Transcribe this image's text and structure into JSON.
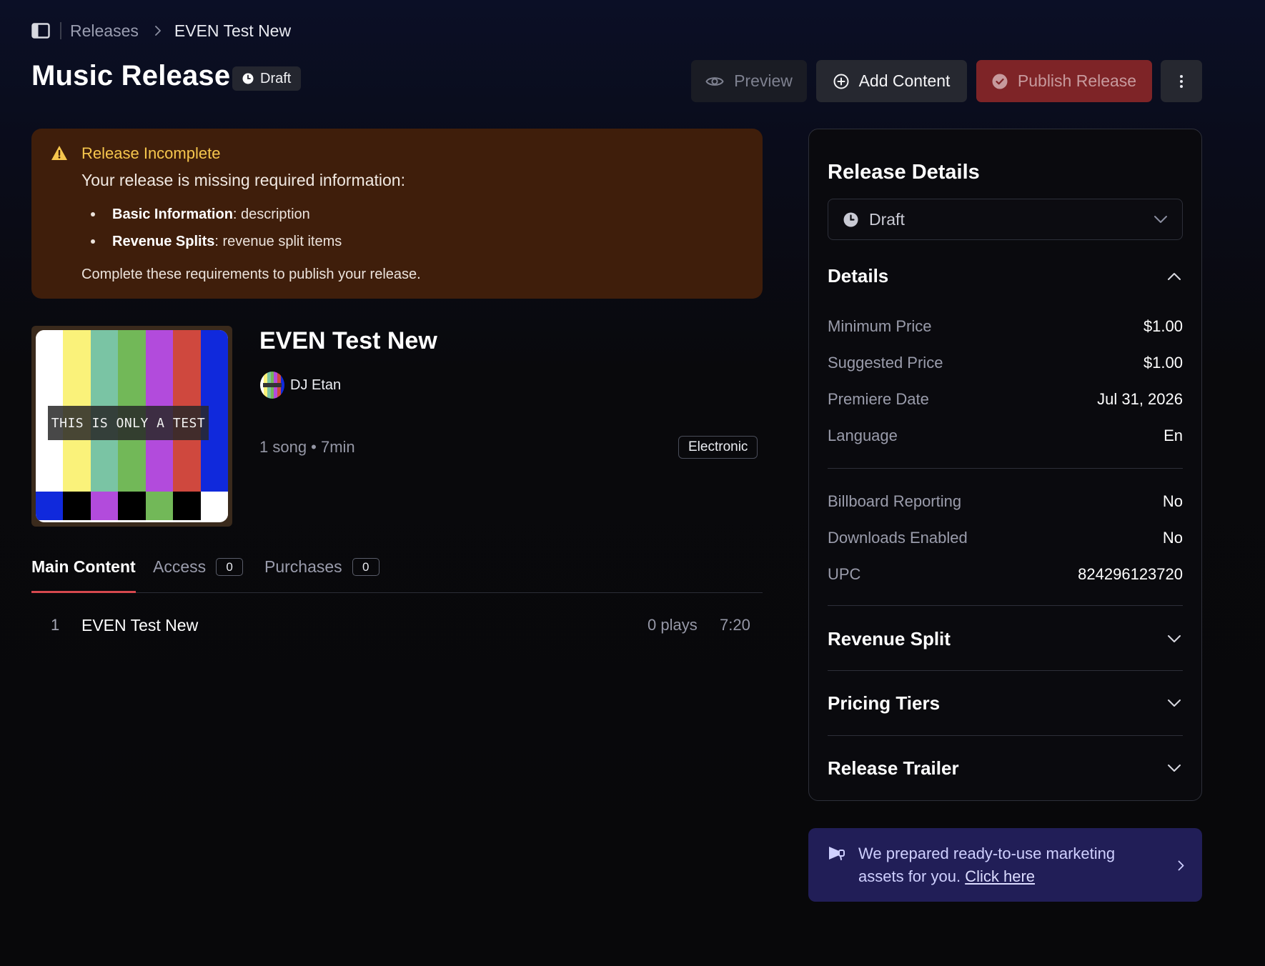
{
  "breadcrumb": {
    "parent": "Releases",
    "current": "EVEN Test New"
  },
  "header": {
    "title": "Music Release",
    "status_badge": "Draft",
    "preview_label": "Preview",
    "add_content_label": "Add Content",
    "publish_label": "Publish Release"
  },
  "alert": {
    "title": "Release Incomplete",
    "message": "Your release is missing required information:",
    "items": [
      {
        "label": "Basic Information",
        "detail": ": description"
      },
      {
        "label": "Revenue Splits",
        "detail": ": revenue split items"
      }
    ],
    "footer": "Complete these requirements to publish your release."
  },
  "release": {
    "cover_text": "THIS IS ONLY A TEST",
    "name": "EVEN Test New",
    "artist": "DJ Etan",
    "meta": "1 song • 7min",
    "genre": "Electronic"
  },
  "tabs": [
    {
      "label": "Main Content"
    },
    {
      "label": "Access",
      "count": "0"
    },
    {
      "label": "Purchases",
      "count": "0"
    }
  ],
  "tracks": [
    {
      "num": "1",
      "title": "EVEN Test New",
      "plays": "0 plays",
      "duration": "7:20"
    }
  ],
  "panel": {
    "title": "Release Details",
    "status_value": "Draft",
    "details_title": "Details",
    "details_rows": [
      {
        "label": "Minimum Price",
        "value": "$1.00"
      },
      {
        "label": "Suggested Price",
        "value": "$1.00"
      },
      {
        "label": "Premiere Date",
        "value": "Jul 31, 2026"
      },
      {
        "label": "Language",
        "value": "En"
      }
    ],
    "details_rows_2": [
      {
        "label": "Billboard Reporting",
        "value": "No"
      },
      {
        "label": "Downloads Enabled",
        "value": "No"
      },
      {
        "label": "UPC",
        "value": "824296123720"
      }
    ],
    "revenue_split_title": "Revenue Split",
    "pricing_tiers_title": "Pricing Tiers",
    "release_trailer_title": "Release Trailer"
  },
  "marketing": {
    "text": "We prepared ready-to-use marketing assets for you.",
    "link": "Click here"
  },
  "colors": {
    "background": "#09090c",
    "alert_bg": "#3f1e0b",
    "alert_title": "#f6c64d",
    "publish_bg": "#7e2427",
    "tab_accent": "#d6484e",
    "marketing_bg": "#211e57"
  }
}
